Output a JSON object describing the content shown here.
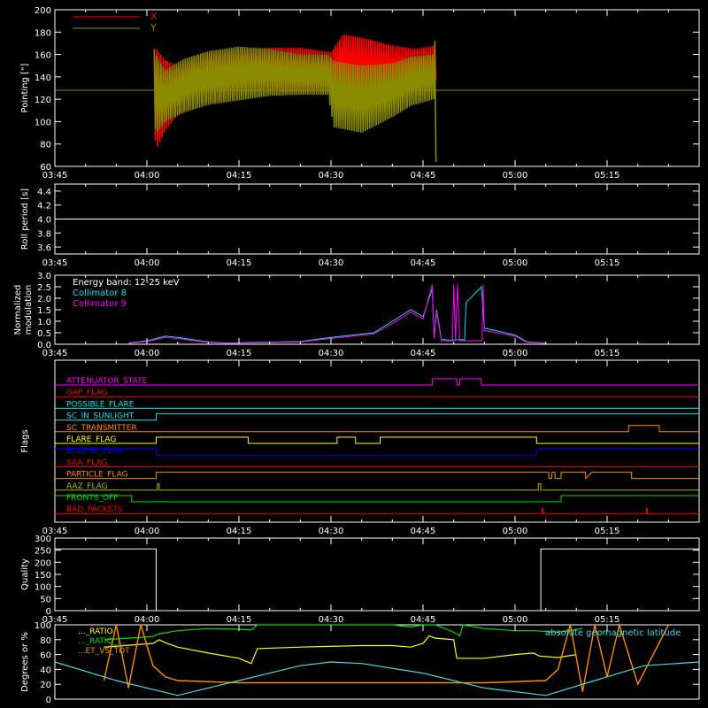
{
  "colors": {
    "background": "#000000",
    "axes": "#ffffff",
    "red": "#ff0000",
    "olive": "#8b8b00",
    "cyan": "#00e5ee",
    "magenta": "#ff00ff",
    "white": "#ffffff",
    "orange": "#ff8c00",
    "yellow": "#ffff00",
    "green": "#00dd00",
    "blue": "#0000ff",
    "lightcyan": "#44d8e0",
    "gold": "#b4b400"
  },
  "chart_data": [
    {
      "type": "line",
      "id": "pointing",
      "ylabel": "Pointing [\"]",
      "ylim": [
        60,
        200
      ],
      "yticks": [
        60,
        80,
        100,
        120,
        140,
        160,
        180,
        200
      ],
      "xlim": [
        0,
        105
      ],
      "xticks": [
        0,
        15,
        30,
        45,
        60,
        75,
        90
      ],
      "xtick_labels": [
        "03:45",
        "04:00",
        "04:15",
        "04:30",
        "04:45",
        "05:00",
        "05:15"
      ],
      "legend_position": "top-left",
      "series": [
        {
          "name": "X",
          "color": "red",
          "envelope": {
            "x": [
              16.2,
              16.5,
              18,
              20,
              23,
              26,
              30,
              35,
              40,
              45,
              47,
              51,
              55,
              59,
              61.8,
              62.2
            ],
            "upper": [
              160,
              165,
              155,
              150,
              158,
              162,
              164,
              166,
              166,
              162,
              178,
              174,
              168,
              165,
              168,
              160
            ],
            "lower": [
              95,
              75,
              92,
              106,
              116,
              118,
              124,
              126,
              126,
              127,
              128,
              122,
              126,
              130,
              128,
              140
            ]
          }
        },
        {
          "name": "Y",
          "color": "olive",
          "baseline": 128,
          "envelope": {
            "x": [
              16.2,
              16.6,
              18,
              21,
              25,
              30,
              35,
              40,
              44.5,
              45.5,
              50,
              55,
              58,
              61.8,
              62.1
            ],
            "upper": [
              165,
              158,
              146,
              156,
              163,
              167,
              165,
              160,
              160,
              154,
              150,
              152,
              158,
              160,
              190
            ],
            "lower": [
              96,
              90,
              100,
              108,
              115,
              119,
              123,
              124,
              124,
              95,
              90,
              104,
              114,
              120,
              64
            ]
          }
        }
      ]
    },
    {
      "type": "line",
      "id": "roll",
      "ylabel": "Roll period [s]",
      "ylim": [
        3.5,
        4.5
      ],
      "yticks": [
        3.6,
        3.8,
        4.0,
        4.2,
        4.4
      ],
      "yticklabels": [
        "3.6",
        "3.8",
        "4.0",
        "4.2",
        "4.4"
      ],
      "xticks": [
        0,
        15,
        30,
        45,
        60,
        75,
        90
      ],
      "xtick_labels": [
        "03:45",
        "04:00",
        "04:15",
        "04:30",
        "04:45",
        "05:00",
        "05:15"
      ],
      "series": [
        {
          "color": "white",
          "x": [
            0,
            105
          ],
          "y": [
            4.0,
            4.0
          ]
        }
      ]
    },
    {
      "type": "line",
      "id": "modulation",
      "ylabel": "Normalized modulation",
      "ylim": [
        0,
        3.0
      ],
      "yticks": [
        0.0,
        0.5,
        1.0,
        1.5,
        2.0,
        2.5,
        3.0
      ],
      "yticklabels": [
        "0.0",
        "0.5",
        "1.0",
        "1.5",
        "2.0",
        "2.5",
        "3.0"
      ],
      "xticks": [
        0,
        15,
        30,
        45,
        60,
        75,
        90
      ],
      "xtick_labels": [
        "03:45",
        "04:00",
        "04:15",
        "04:30",
        "04:45",
        "05:00",
        "05:15"
      ],
      "annotation": "Energy band: 12-25 keV",
      "series": [
        {
          "name": "Collimator 8",
          "color": "cyan",
          "x": [
            12,
            15,
            18,
            20,
            25,
            28,
            33,
            40,
            45,
            52,
            55,
            58,
            60,
            61.5,
            61.8,
            62.2,
            63,
            63.5,
            64,
            66.5,
            66.8,
            67,
            69.5,
            70,
            75,
            77,
            80
          ],
          "y": [
            0.05,
            0.15,
            0.35,
            0.3,
            0.1,
            0.05,
            0.08,
            0.12,
            0.3,
            0.5,
            1.0,
            1.5,
            1.2,
            2.4,
            0.3,
            1.5,
            0.2,
            0.2,
            0.18,
            0.2,
            0.18,
            1.8,
            2.5,
            0.7,
            0.4,
            0.1,
            0.05
          ]
        },
        {
          "name": "Collimator 9",
          "color": "magenta",
          "x": [
            12,
            15,
            18,
            20,
            25,
            28,
            33,
            40,
            45,
            52,
            55,
            58,
            60,
            61.5,
            61.8,
            62.2,
            63,
            64.8,
            65,
            65.3,
            65.6,
            66,
            69.6,
            69.8,
            70,
            75,
            77,
            80
          ],
          "y": [
            0.04,
            0.12,
            0.3,
            0.25,
            0.08,
            0.04,
            0.06,
            0.1,
            0.25,
            0.45,
            0.9,
            1.4,
            1.1,
            2.6,
            0.25,
            1.4,
            0.15,
            0.15,
            2.6,
            0.15,
            2.6,
            0.15,
            0.15,
            2.6,
            0.6,
            0.35,
            0.08,
            0.04
          ]
        }
      ]
    },
    {
      "type": "line",
      "id": "flags",
      "ylabel": "Flags",
      "xticks": [
        0,
        15,
        30,
        45,
        60,
        75,
        90
      ],
      "xtick_labels": [
        "03:45",
        "04:00",
        "04:15",
        "04:30",
        "04:45",
        "05:00",
        "05:15"
      ],
      "series": [
        {
          "name": "ATTENUATOR_STATE",
          "color": "magenta",
          "x": [
            0,
            61.5,
            61.5,
            65.5,
            65.5,
            66,
            66,
            69.5,
            69.5,
            105
          ],
          "y": [
            0,
            0,
            1,
            1,
            0,
            0,
            1,
            1,
            0,
            0
          ]
        },
        {
          "name": "GAP_FLAG",
          "color": "red",
          "x": [
            0,
            105
          ],
          "y": [
            0,
            0
          ]
        },
        {
          "name": "POSSIBLE_FLARE",
          "color": "cyan",
          "x": [
            0,
            105
          ],
          "y": [
            0,
            0
          ]
        },
        {
          "name": "SC_IN_SUNLIGHT",
          "color": "cyan",
          "x": [
            0,
            16.5,
            16.5,
            105
          ],
          "y": [
            0,
            0,
            1,
            1
          ]
        },
        {
          "name": "SC_TRANSMITTER",
          "color": "orange",
          "x": [
            0,
            93.5,
            93.5,
            98.5,
            98.5,
            105
          ],
          "y": [
            0,
            0,
            1,
            1,
            0,
            0
          ]
        },
        {
          "name": "FLARE_FLAG",
          "color": "yellow",
          "x": [
            0,
            16.5,
            16.5,
            31.5,
            31.5,
            46,
            46,
            49,
            49,
            53,
            53,
            78.5,
            78.5,
            105
          ],
          "y": [
            0,
            0,
            1,
            1,
            0,
            0,
            1,
            1,
            0,
            0,
            1,
            1,
            0,
            0
          ]
        },
        {
          "name": "ECLIPSE_FLAG",
          "color": "blue",
          "x": [
            0,
            16.5,
            16.5,
            78.5,
            78.5,
            105
          ],
          "y": [
            1,
            1,
            0,
            0,
            1,
            1
          ]
        },
        {
          "name": "SAA_FLAG",
          "color": "red",
          "x": [
            0,
            105
          ],
          "y": [
            0,
            0
          ]
        },
        {
          "name": "PARTICLE_FLAG",
          "color": "orange",
          "x": [
            0,
            16.5,
            16.5,
            80.5,
            80.5,
            81,
            81,
            81.5,
            81.5,
            82.5,
            82.5,
            86.5,
            86.5,
            87.5,
            87.5,
            94,
            94,
            105
          ],
          "y": [
            0,
            0,
            1,
            1,
            0,
            0,
            1,
            1,
            0,
            0,
            1,
            1,
            0,
            1,
            1,
            1,
            0,
            0
          ]
        },
        {
          "name": "AAZ_FLAG",
          "color": "gold",
          "x": [
            0,
            16.7,
            16.7,
            17,
            17,
            78.8,
            78.8,
            79.2,
            79.2,
            105
          ],
          "y": [
            0,
            0,
            1,
            1,
            0,
            0,
            1,
            1,
            0,
            0
          ]
        },
        {
          "name": "FRONTS_OFF",
          "color": "green",
          "x": [
            0,
            12.5,
            12.5,
            82.5,
            82.5,
            105
          ],
          "y": [
            1,
            1,
            0,
            0,
            1,
            1
          ]
        },
        {
          "name": "BAD_PACKETS",
          "color": "red",
          "x": [
            0,
            105
          ],
          "y": [
            0,
            0
          ],
          "spikes": [
            79.5,
            96.5
          ]
        }
      ]
    },
    {
      "type": "line",
      "id": "quality",
      "ylabel": "Quality",
      "ylim": [
        0,
        300
      ],
      "yticks": [
        0,
        50,
        100,
        150,
        200,
        250,
        300
      ],
      "xticks": [
        0,
        15,
        30,
        45,
        60,
        75,
        90
      ],
      "xtick_labels": [
        "03:45",
        "04:00",
        "04:15",
        "04:30",
        "04:45",
        "05:00",
        "05:15"
      ],
      "series": [
        {
          "color": "white",
          "x": [
            0,
            16.5,
            16.5,
            79.2,
            79.2,
            105
          ],
          "y": [
            255,
            255,
            0,
            0,
            255,
            255
          ]
        }
      ]
    },
    {
      "type": "line",
      "id": "ratios",
      "ylabel": "Degrees or %",
      "ylim": [
        0,
        100
      ],
      "yticks": [
        0,
        20,
        40,
        60,
        80,
        100
      ],
      "xticks": [
        0,
        15,
        30,
        45,
        60,
        75,
        90
      ],
      "xtick_labels": [
        "03:45",
        "04:00",
        "04:15",
        "04:30",
        "04:45",
        "05:00",
        "05:15"
      ],
      "legend_left": [
        "..._RATIO",
        "..._RATIO_...",
        "...ET_VS_TOT"
      ],
      "legend_right": "absolute geomagnetic latitude",
      "series": [
        {
          "name": "green ratio",
          "color": "green",
          "x": [
            8,
            16,
            17,
            20,
            25,
            30,
            32,
            33,
            40,
            45,
            55,
            58,
            60,
            62,
            65,
            66,
            66.5,
            70,
            75,
            78,
            82,
            86
          ],
          "y": [
            80,
            84,
            88,
            92,
            95,
            94,
            93,
            100,
            100,
            100,
            100,
            97,
            100,
            100,
            90,
            85,
            100,
            95,
            92,
            92,
            90,
            95
          ]
        },
        {
          "name": "yellow ratio",
          "color": "yellow",
          "x": [
            8,
            16,
            17,
            18,
            20,
            25,
            30,
            32,
            33,
            40,
            50,
            55,
            58,
            60,
            61,
            62,
            65,
            65.5,
            66,
            70,
            75,
            78,
            79,
            82,
            85
          ],
          "y": [
            70,
            75,
            80,
            76,
            70,
            62,
            55,
            48,
            68,
            70,
            72,
            72,
            70,
            75,
            85,
            82,
            80,
            55,
            55,
            55,
            60,
            62,
            58,
            56,
            60
          ]
        },
        {
          "name": "orange ratio",
          "color": "orange",
          "x": [
            8,
            10,
            12,
            14,
            16,
            18,
            20,
            30,
            40,
            50,
            60,
            70,
            80,
            82,
            84,
            86,
            88,
            90,
            92,
            95,
            100
          ],
          "y": [
            25,
            100,
            15,
            100,
            45,
            30,
            25,
            22,
            22,
            22,
            22,
            22,
            25,
            40,
            100,
            10,
            100,
            30,
            100,
            20,
            100
          ]
        },
        {
          "name": "absolute geomagnetic latitude",
          "color": "lightcyan",
          "x": [
            0,
            10,
            20,
            30,
            40,
            45,
            50,
            60,
            70,
            80,
            88,
            96,
            105
          ],
          "y": [
            50,
            25,
            5,
            25,
            45,
            50,
            48,
            35,
            15,
            5,
            25,
            45,
            50
          ]
        }
      ]
    }
  ]
}
